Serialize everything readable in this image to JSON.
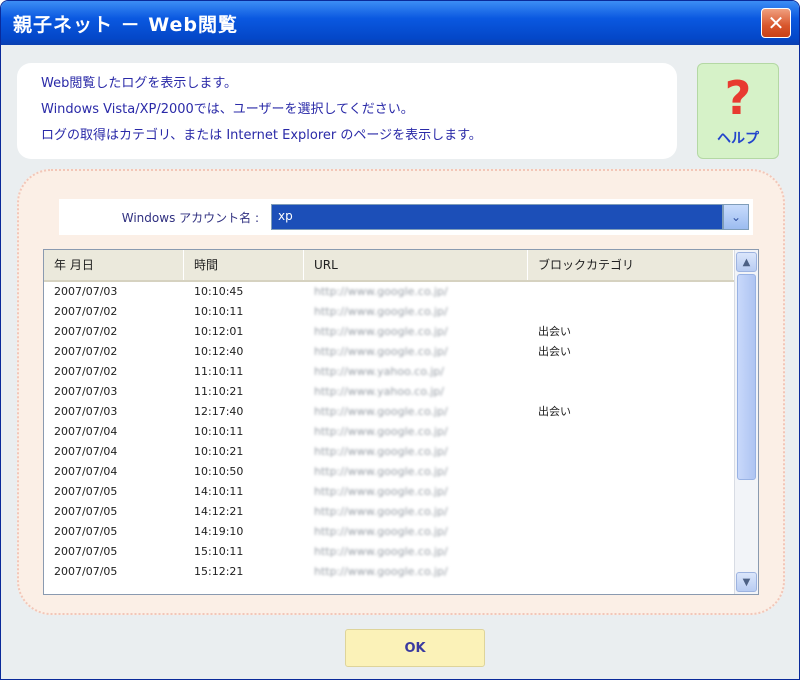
{
  "window": {
    "title": "親子ネット － Web閲覧",
    "close_glyph": "✕"
  },
  "info": {
    "lines": [
      "Web閲覧したログを表示します。",
      "Windows Vista/XP/2000では、ユーザーを選択してください。",
      "ログの取得はカテゴリ、または Internet Explorer のページを表示します。"
    ]
  },
  "help": {
    "glyph": "?",
    "label": "ヘルプ"
  },
  "account": {
    "label": "Windows アカウント名 :",
    "selected": "xp",
    "dropdown_glyph": "⌄"
  },
  "table": {
    "headers": [
      "年 月日",
      "時間",
      "URL",
      "ブロックカテゴリ"
    ],
    "rows": [
      {
        "date": "2007/07/03",
        "time": "10:10:45",
        "url": "http://www.google.co.jp/",
        "category": ""
      },
      {
        "date": "2007/07/02",
        "time": "10:10:11",
        "url": "http://www.google.co.jp/",
        "category": ""
      },
      {
        "date": "2007/07/02",
        "time": "10:12:01",
        "url": "http://www.google.co.jp/",
        "category": "出会い"
      },
      {
        "date": "2007/07/02",
        "time": "10:12:40",
        "url": "http://www.google.co.jp/",
        "category": "出会い"
      },
      {
        "date": "2007/07/02",
        "time": "11:10:11",
        "url": "http://www.yahoo.co.jp/",
        "category": ""
      },
      {
        "date": "2007/07/03",
        "time": "11:10:21",
        "url": "http://www.yahoo.co.jp/",
        "category": ""
      },
      {
        "date": "2007/07/03",
        "time": "12:17:40",
        "url": "http://www.google.co.jp/",
        "category": "出会い"
      },
      {
        "date": "2007/07/04",
        "time": "10:10:11",
        "url": "http://www.google.co.jp/",
        "category": ""
      },
      {
        "date": "2007/07/04",
        "time": "10:10:21",
        "url": "http://www.google.co.jp/",
        "category": ""
      },
      {
        "date": "2007/07/04",
        "time": "10:10:50",
        "url": "http://www.google.co.jp/",
        "category": ""
      },
      {
        "date": "2007/07/05",
        "time": "14:10:11",
        "url": "http://www.google.co.jp/",
        "category": ""
      },
      {
        "date": "2007/07/05",
        "time": "14:12:21",
        "url": "http://www.google.co.jp/",
        "category": ""
      },
      {
        "date": "2007/07/05",
        "time": "14:19:10",
        "url": "http://www.google.co.jp/",
        "category": ""
      },
      {
        "date": "2007/07/05",
        "time": "15:10:11",
        "url": "http://www.google.co.jp/",
        "category": ""
      },
      {
        "date": "2007/07/05",
        "time": "15:12:21",
        "url": "http://www.google.co.jp/",
        "category": ""
      }
    ]
  },
  "ok_button": {
    "label": "OK"
  },
  "colors": {
    "title_bar": "#0a58e0",
    "panel_bg": "#fbefe6",
    "ok_bg": "#fbf2b8",
    "help_bg": "#d6f2c8"
  },
  "icons": {
    "help": "question-mark-icon",
    "close": "close-icon",
    "dropdown": "chevron-down-icon"
  }
}
